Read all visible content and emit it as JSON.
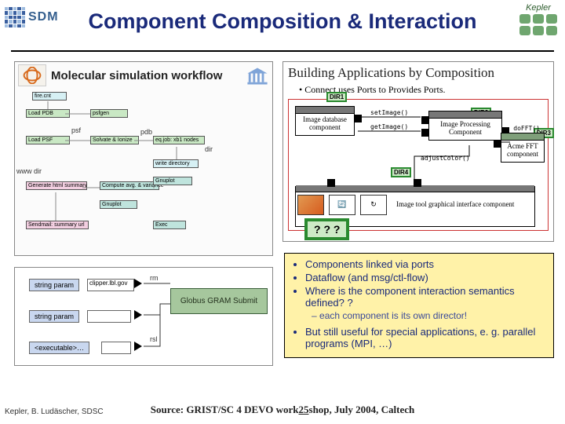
{
  "header": {
    "logo_text": "SDM",
    "brand_right": "Kepler",
    "title": "Component Composition & Interaction"
  },
  "fig_mol": {
    "title": "Molecular simulation workflow",
    "boxes": {
      "firecnt": "fire.cnt",
      "loadpdb": "Load PDB",
      "psfgen": "psfgen",
      "loadpsf": "Load PSF",
      "solvate": "Solvate & Ionize",
      "eqjob": "eq.job: xb1 nodes",
      "writedir": "write directory",
      "genhtml": "Generate html summary",
      "compavg": "Compute avg. & variance",
      "gnuplot": "Gnuplot",
      "sendmail": "Sendmail: summary url",
      "exec": "Exec"
    },
    "edges": {
      "psf": "psf",
      "pdb": "pdb",
      "dir": "dir",
      "wwwdir": "www dir"
    }
  },
  "fig_comp": {
    "title": "Building Applications by Composition",
    "bullet": "Connect uses Ports to Provides Ports.",
    "components": {
      "imgdb": "Image database component",
      "imgproc": "Image Processing Component",
      "acme": "Acme FFT component",
      "imgtool": "Image tool graphical interface component"
    },
    "ports": {
      "setimage": "setImage()",
      "getimage": "getImage()",
      "adjustcolor": "adjustColor()",
      "dofft": "doFFT()"
    },
    "dir1": "DIR1",
    "dir2": "DIR2",
    "dir3": "DIR3",
    "dir4": "DIR4",
    "qmarks": "? ? ?"
  },
  "notes": {
    "b1": "Components linked via ports",
    "b2": "Dataflow (and msg/ctl-flow)",
    "b3": "Where is the component interaction semantics defined? ?",
    "b3s": "each component is its own director!",
    "b4": "But still useful for special applications, e. g. parallel programs (MPI, …)"
  },
  "fig_globus": {
    "param_label": "string param",
    "exec_label": "<executable>…",
    "gram": "Globus GRAM Submit",
    "host": "clipper.lbl.gov",
    "rm": "rm",
    "rsl": "rsl"
  },
  "footer": {
    "left": "Kepler, B. Ludäscher, SDSC",
    "mid_a": "Source: GRIST/SC 4 DEVO work",
    "mid_num": "25",
    "mid_b": "shop, July 2004, Caltech"
  }
}
